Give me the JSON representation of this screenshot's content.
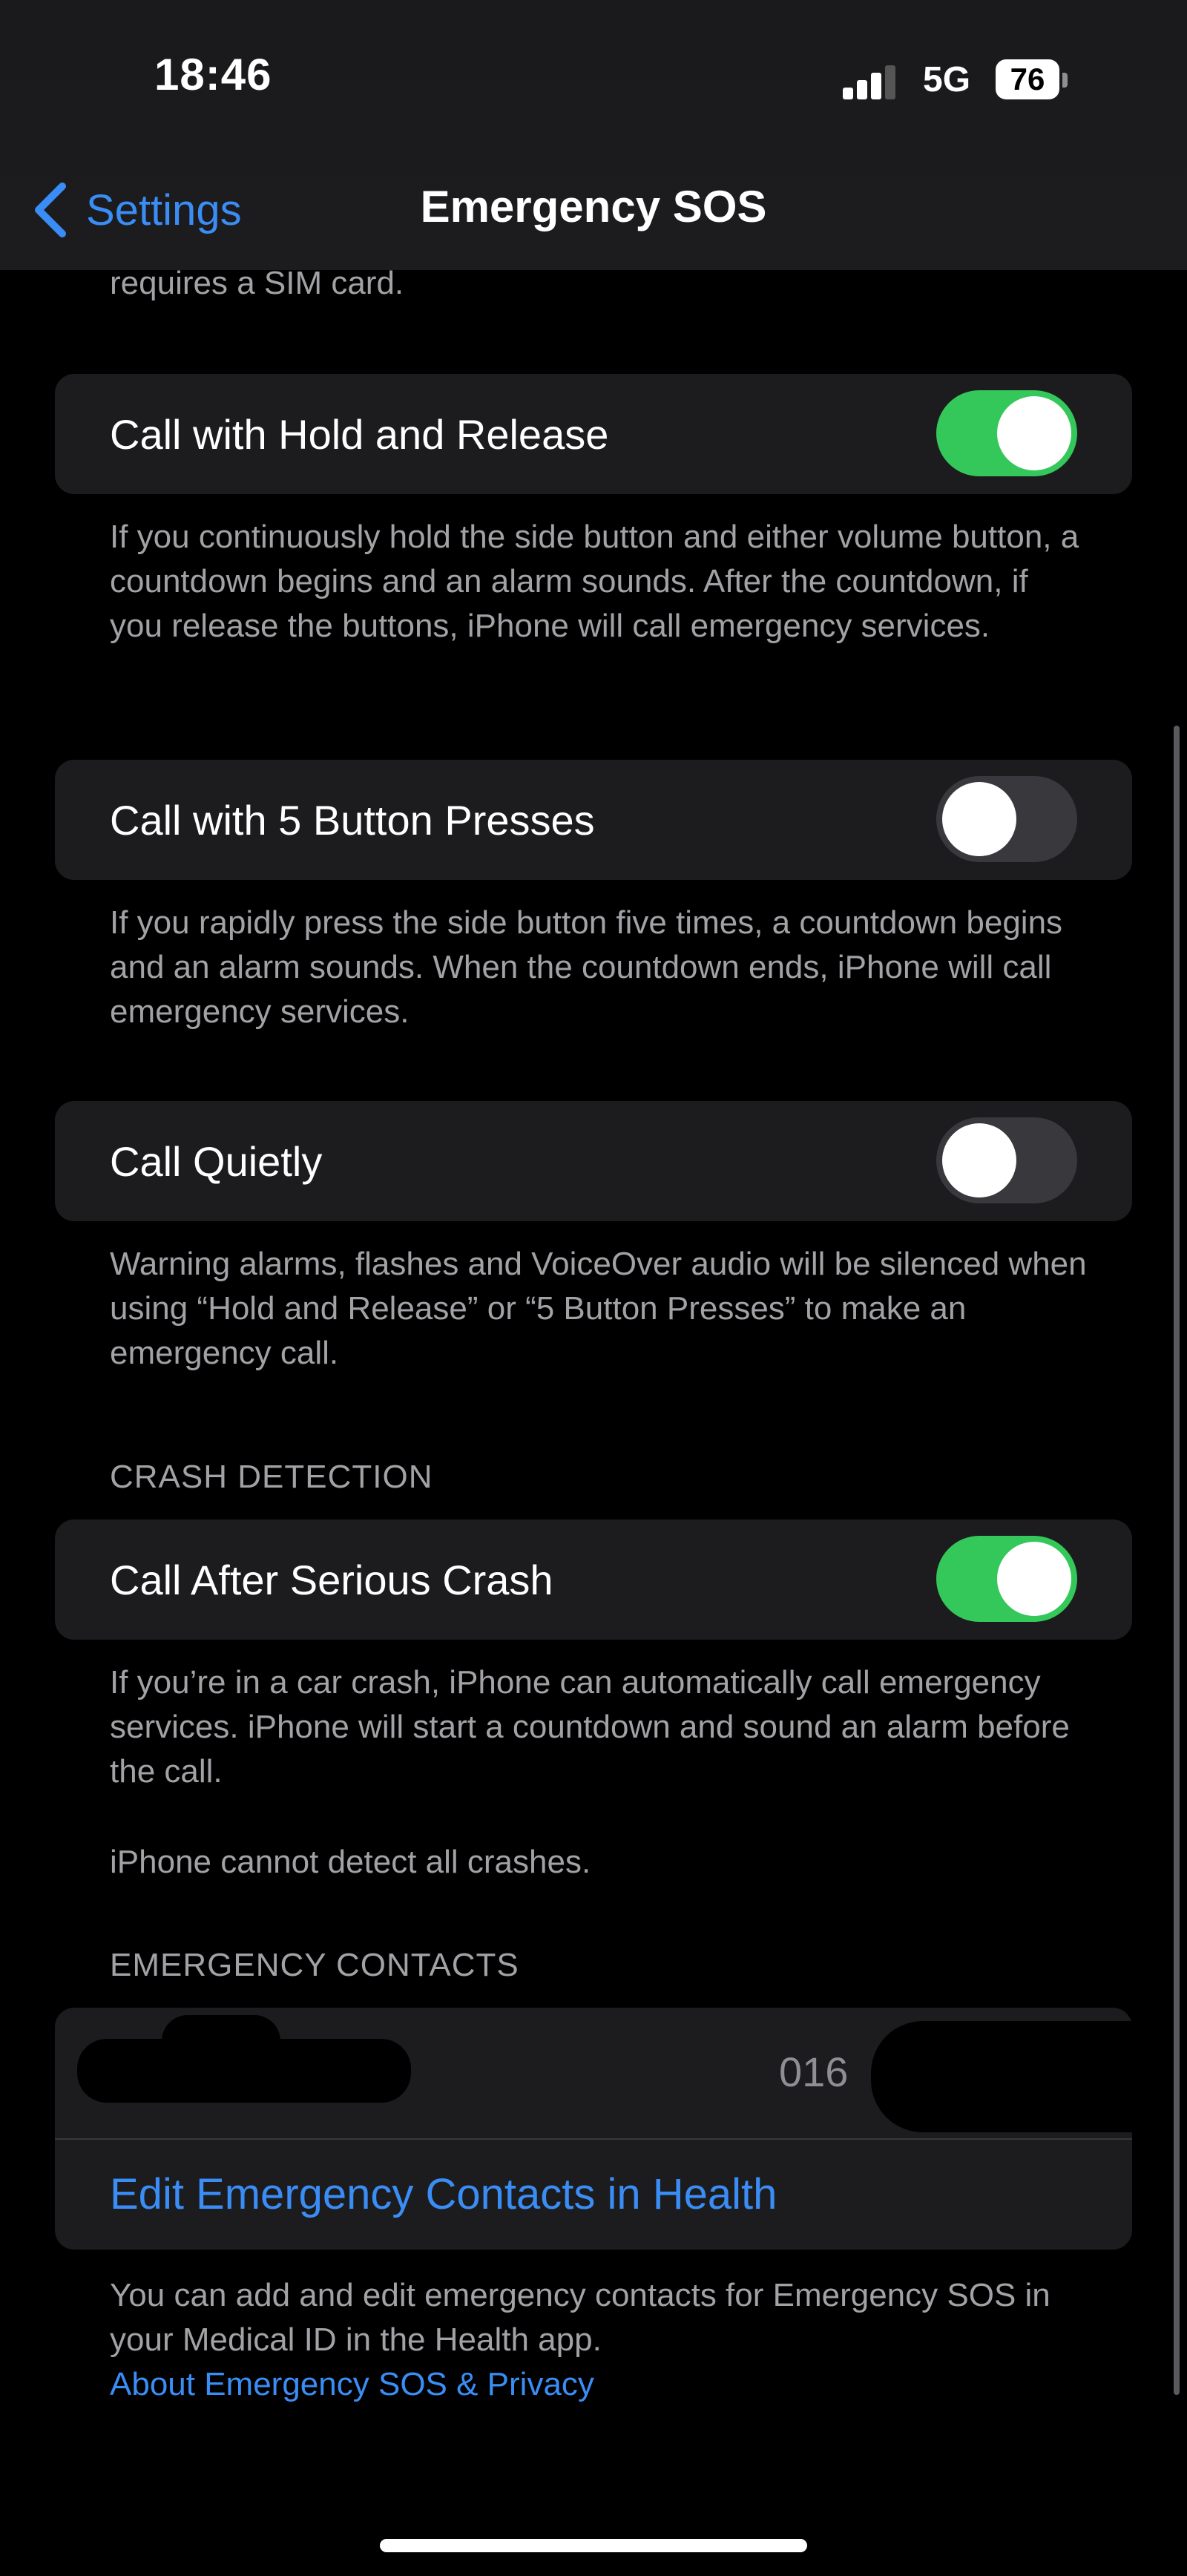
{
  "status_bar": {
    "time": "18:46",
    "network": "5G",
    "battery": "76"
  },
  "nav": {
    "back_label": "Settings",
    "title": "Emergency SOS"
  },
  "partial_top_text": "requires a SIM card.",
  "settings": [
    {
      "label": "Call with Hold and Release",
      "on": true,
      "footer": "If you continuously hold the side button and either volume button, a countdown begins and an alarm sounds. After the countdown, if you release the buttons, iPhone will call emergency services."
    },
    {
      "label": "Call with 5 Button Presses",
      "on": false,
      "footer": "If you rapidly press the side button five times, a countdown begins and an alarm sounds. When the countdown ends, iPhone will call emergency services."
    },
    {
      "label": "Call Quietly",
      "on": false,
      "footer": "Warning alarms, flashes and VoiceOver audio will be silenced when using “Hold and Release” or “5 Button Presses” to make an emergency call."
    }
  ],
  "crash_detection": {
    "header": "CRASH DETECTION",
    "label": "Call After Serious Crash",
    "on": true,
    "footer_1": "If you’re in a car crash, iPhone can automatically call emergency services. iPhone will start a countdown and sound an alarm before the call.",
    "footer_2": "iPhone cannot detect all crashes."
  },
  "emergency_contacts": {
    "header": "EMERGENCY CONTACTS",
    "contact_phone_visible": "016",
    "edit_link": "Edit Emergency Contacts in Health",
    "footer": "You can add and edit emergency contacts for Emergency SOS in your Medical ID in the Health app.",
    "privacy_link": "About Emergency SOS & Privacy"
  },
  "colors": {
    "accent": "#3a8df5",
    "toggle_on": "#34c759",
    "toggle_off": "#39393d",
    "group_bg": "#1c1c1e",
    "secondary_text": "#a1a1a6"
  }
}
